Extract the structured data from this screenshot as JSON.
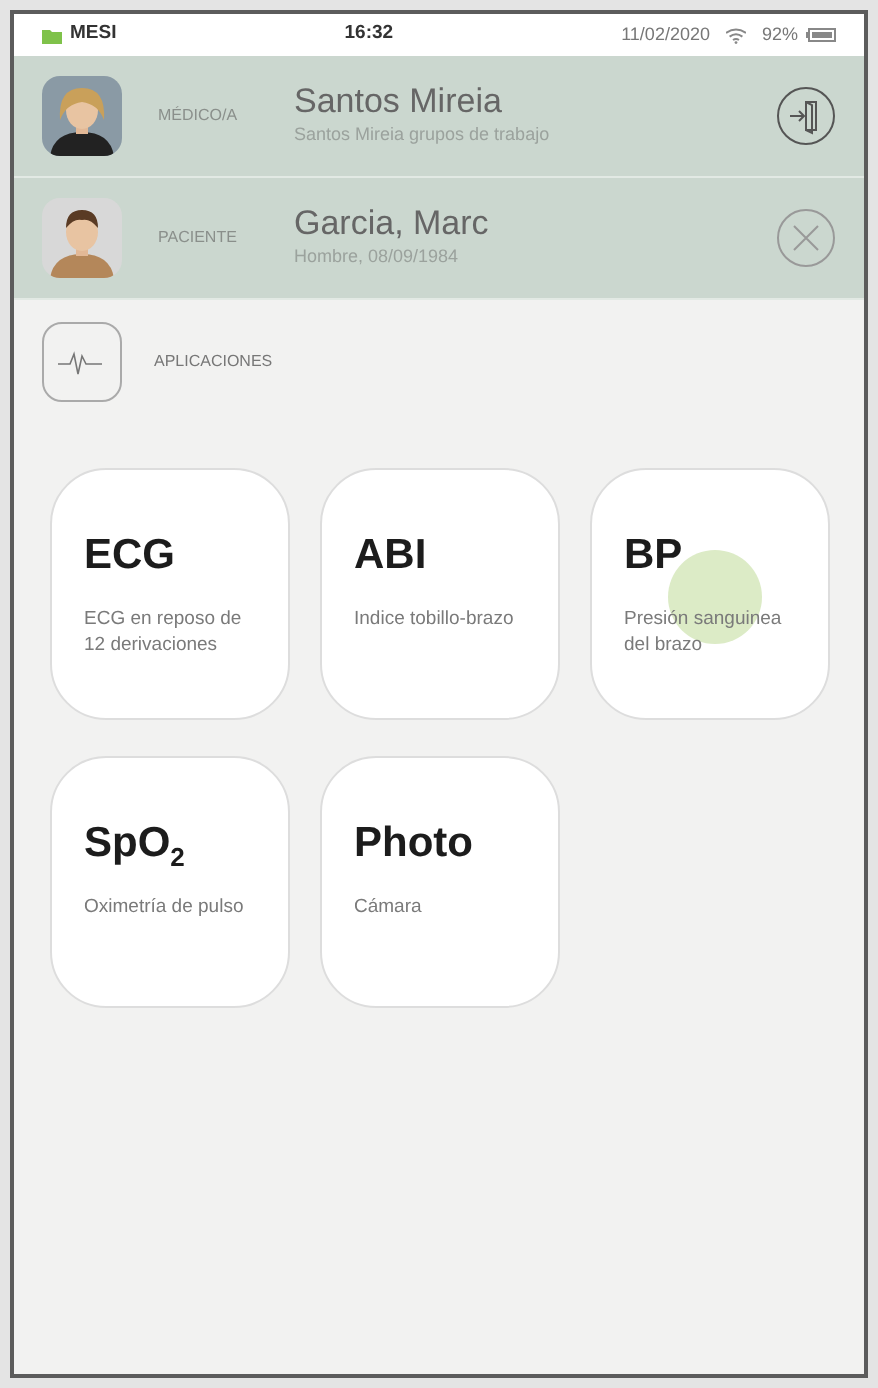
{
  "status_bar": {
    "brand": "MESI",
    "time": "16:32",
    "date": "11/02/2020",
    "battery": "92%"
  },
  "users": [
    {
      "role": "MÉDICO/A",
      "name": "Santos Mireia",
      "detail": "Santos Mireia grupos de trabajo",
      "kind": "logout"
    },
    {
      "role": "PACIENTE",
      "name": "Garcia, Marc",
      "detail": "Hombre, 08/09/1984",
      "kind": "close"
    }
  ],
  "section": {
    "title": "APLICACIONES"
  },
  "apps": [
    {
      "title": "ECG",
      "subtitle": "ECG en reposo de 12 derivaciones",
      "touched": false
    },
    {
      "title": "ABI",
      "subtitle": "Indice tobillo-brazo",
      "touched": false
    },
    {
      "title": "BP",
      "subtitle": "Presión sanguinea del brazo",
      "touched": true
    },
    {
      "title": "SpO$_{2}$",
      "subtitle": "Oximetría de pulso",
      "touched": false
    },
    {
      "title": "Photo",
      "subtitle": "Cámara",
      "touched": false
    }
  ]
}
